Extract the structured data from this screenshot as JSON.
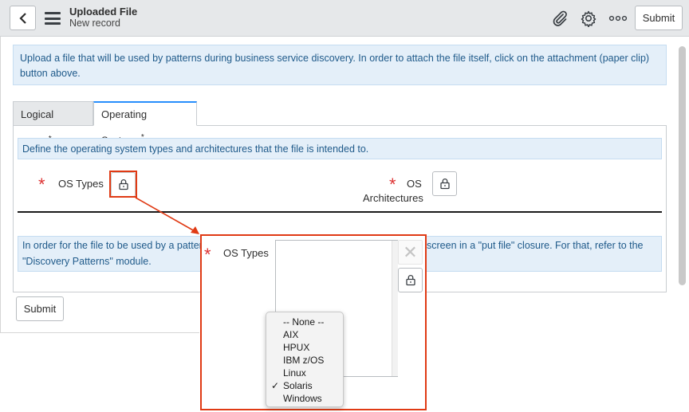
{
  "header": {
    "title": "Uploaded File",
    "subtitle": "New record",
    "submit_label": "Submit"
  },
  "icons": {
    "back": "chevron-left-icon",
    "menu": "hamburger-icon",
    "attachment": "paperclip-icon",
    "settings": "gear-icon",
    "more": "ellipsis-icon",
    "lock": "lock-icon",
    "clear": "close-icon",
    "check": "checkmark-icon"
  },
  "info_main": "Upload a file that will be used by patterns during business service discovery. In order to attach the file itself, click on the attachment (paper clip) button above.",
  "tabs": [
    {
      "label": "Logical Name",
      "required": "*"
    },
    {
      "label": "Operating Systems",
      "required": "*"
    }
  ],
  "os_tab": {
    "info": "Define the operating system types and architectures that the file is intended to.",
    "os_types_label": "OS Types",
    "os_arch_label_line1": "OS",
    "os_arch_label_line2": "Architectures",
    "info_bottom_part1": "In order for the file to be used by a pattern",
    "info_bottom_part2": "screen in a \"put file\" closure. For that, refer to the",
    "info_bottom_line2": "\"Discovery Patterns\" module."
  },
  "callout": {
    "label": "OS Types",
    "options": [
      "-- None --",
      "AIX",
      "HPUX",
      "IBM z/OS",
      "Linux",
      "Solaris",
      "Windows"
    ],
    "selected": "Solaris",
    "check_mark": "✓"
  },
  "bottom_submit_label": "Submit",
  "colors": {
    "accent": "#278efc",
    "required": "#dd3333",
    "callout_border": "#e03a14",
    "info_bg": "#e4eff9",
    "info_text": "#1f5a8a"
  }
}
